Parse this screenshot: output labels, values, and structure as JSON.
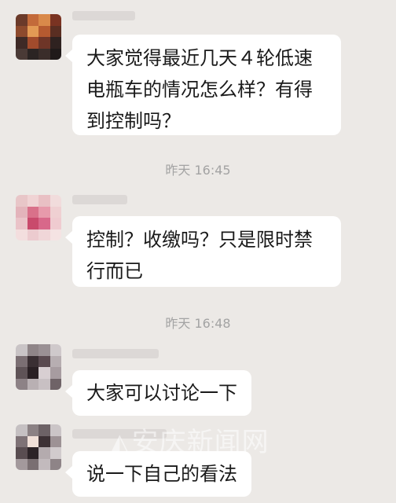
{
  "chat": {
    "messages": [
      {
        "text": "大家觉得最近几天４轮低速电瓶车的情况怎么样？有得到控制吗？"
      },
      {
        "text": "控制？收缴吗？只是限时禁行而已"
      },
      {
        "text": "大家可以讨论一下"
      },
      {
        "text": "说一下自己的看法"
      }
    ],
    "timestamps": [
      "昨天 16:45",
      "昨天 16:48"
    ]
  },
  "watermark": {
    "text": "安庆新闻网"
  },
  "colors": {
    "background": "#ece9e6",
    "bubble": "#ffffff",
    "timestamp": "#a3a3a3",
    "text": "#1a1a1a"
  },
  "icons": {
    "avatar": "pixelated-avatar",
    "watermark_mark": "logo-mark"
  }
}
